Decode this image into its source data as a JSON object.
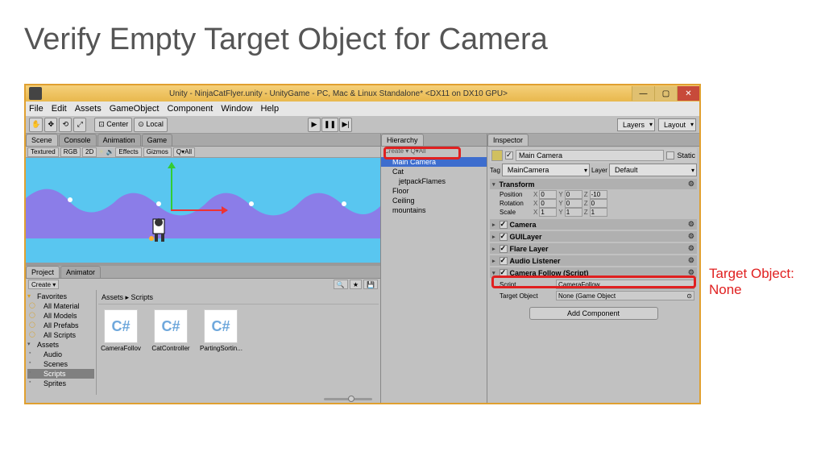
{
  "slide": {
    "title": "Verify Empty Target Object for Camera"
  },
  "annotation": "Target Object: None",
  "window": {
    "title": "Unity - NinjaCatFlyer.unity - UnityGame - PC, Mac & Linux Standalone* <DX11 on DX10 GPU>",
    "win_min": "—",
    "win_max": "▢",
    "win_close": "✕"
  },
  "menubar": [
    "File",
    "Edit",
    "Assets",
    "GameObject",
    "Component",
    "Window",
    "Help"
  ],
  "toolbar": {
    "hand": "✋",
    "move": "✥",
    "rotate": "⟲",
    "scale": "⤢",
    "center": "⊡ Center",
    "local": "⊙ Local",
    "play": "▶",
    "pause": "❚❚",
    "step": "▶|",
    "layers": "Layers",
    "layout": "Layout"
  },
  "scene_tabs": [
    "Scene",
    "Console",
    "Animation",
    "Game"
  ],
  "scene_toolbar": {
    "textured": "Textured",
    "rgb": "RGB",
    "twod": "2D",
    "effects": "Effects",
    "gizmos": "Gizmos",
    "search": "Q▾All"
  },
  "project": {
    "tab_project": "Project",
    "tab_animator": "Animator",
    "create": "Create ▾",
    "favorites": "Favorites",
    "fav_items": [
      "All Material",
      "All Models",
      "All Prefabs",
      "All Scripts"
    ],
    "assets": "Assets",
    "folders": [
      "Audio",
      "Scenes",
      "Scripts",
      "Sprites"
    ],
    "breadcrumb": "Assets ▸ Scripts",
    "files": [
      "CameraFollov",
      "CatController",
      "PartingSortin..."
    ],
    "csharp": "C#"
  },
  "hierarchy": {
    "tab": "Hierarchy",
    "create": "Create ▾  Q▾All",
    "items": [
      "Main Camera",
      "Cat",
      "jetpackFlames",
      "Floor",
      "Ceiling",
      "mountains"
    ]
  },
  "inspector": {
    "tab": "Inspector",
    "name": "Main Camera",
    "static": "Static",
    "tag_label": "Tag",
    "tag_val": "MainCamera",
    "layer_label": "Layer",
    "layer_val": "Default",
    "transform": {
      "title": "Transform",
      "position": "Position",
      "rotation": "Rotation",
      "scale": "Scale",
      "px": "0",
      "py": "0",
      "pz": "-10",
      "rx": "0",
      "ry": "0",
      "rz": "0",
      "sx": "1",
      "sy": "1",
      "sz": "1"
    },
    "comp_camera": "Camera",
    "comp_guilayer": "GUILayer",
    "comp_flare": "Flare Layer",
    "comp_audio": "Audio Listener",
    "comp_script": {
      "title": "Camera Follow (Script)",
      "script_label": "Script",
      "script_val": "CameraFollow",
      "target_label": "Target Object",
      "target_val": "None (Game Object"
    },
    "add_component": "Add Component"
  }
}
